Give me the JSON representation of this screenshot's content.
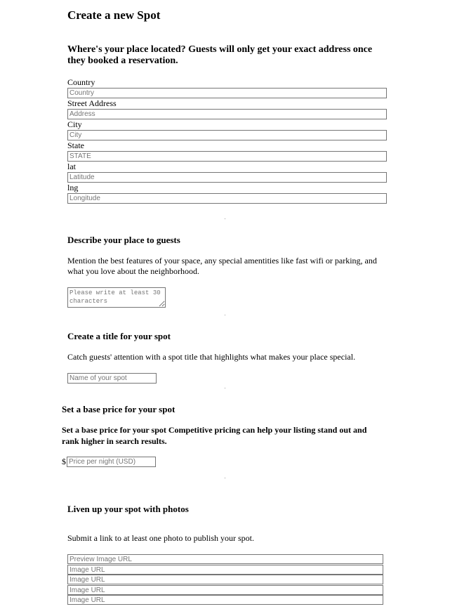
{
  "page": {
    "title": "Create a new Spot"
  },
  "location": {
    "heading": "Where's your place located? Guests will only get your exact address once they booked a reservation.",
    "fields": [
      {
        "label": "Country",
        "placeholder": "Country"
      },
      {
        "label": "Street Address",
        "placeholder": "Address"
      },
      {
        "label": "City",
        "placeholder": "City"
      },
      {
        "label": "State",
        "placeholder": "STATE"
      },
      {
        "label": "lat",
        "placeholder": "Latitude"
      },
      {
        "label": "lng",
        "placeholder": "Longitude"
      }
    ]
  },
  "describe": {
    "heading": "Describe your place to guests",
    "text": "Mention the best features of your space, any special amentities like fast wifi or parking, and what you love about the neighborhood.",
    "placeholder": "Please write at least 30 characters"
  },
  "title_section": {
    "heading": "Create a title for your spot",
    "text": "Catch guests' attention with a spot title that highlights what makes your place special.",
    "placeholder": "Name of your spot"
  },
  "price": {
    "heading": "Set a base price for your spot",
    "text": "Set a base price for your spot Competitive pricing can help your listing stand out and rank higher in search results.",
    "currency": "$",
    "placeholder": "Price per night (USD)"
  },
  "photos": {
    "heading": "Liven up your spot with photos",
    "text": "Submit a link to at least one photo to publish your spot.",
    "placeholders": [
      "Preview Image URL",
      "Image URL",
      "Image URL",
      "Image URL",
      "Image URL"
    ]
  }
}
